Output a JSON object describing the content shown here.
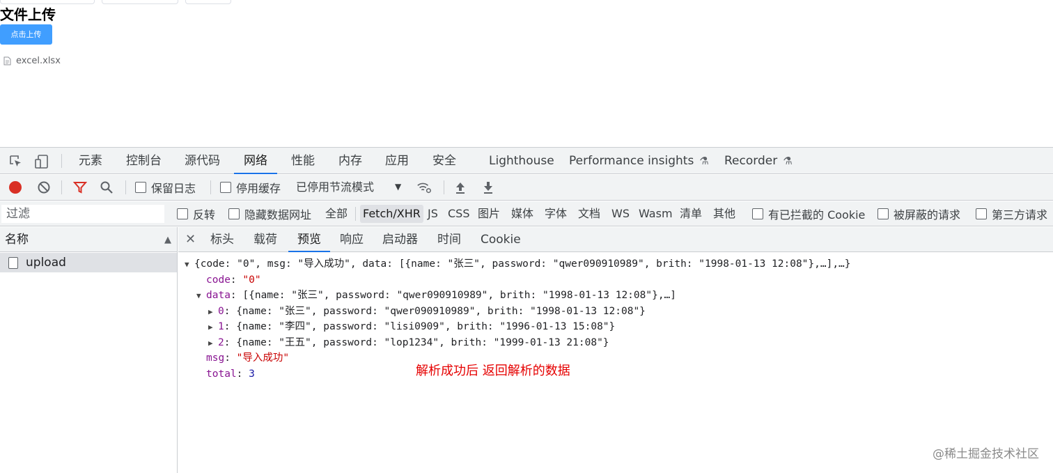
{
  "page": {
    "title": "文件上传",
    "upload_button": "点击上传",
    "file_name": "excel.xlsx"
  },
  "devtools": {
    "tabs": [
      "元素",
      "控制台",
      "源代码",
      "网络",
      "性能",
      "内存",
      "应用",
      "安全",
      "Lighthouse",
      "Performance insights",
      "Recorder"
    ],
    "active_tab": "网络",
    "toolbar": {
      "preserve_log": "保留日志",
      "disable_cache": "停用缓存",
      "throttling": "已停用节流模式"
    },
    "filter": {
      "placeholder": "过滤",
      "invert": "反转",
      "hide_data_urls": "隐藏数据网址",
      "types": [
        "全部",
        "Fetch/XHR",
        "JS",
        "CSS",
        "图片",
        "媒体",
        "字体",
        "文档",
        "WS",
        "Wasm",
        "清单",
        "其他"
      ],
      "selected_type": "Fetch/XHR",
      "blocked_cookies": "有已拦截的 Cookie",
      "blocked_requests": "被屏蔽的请求",
      "third_party": "第三方请求"
    },
    "request_list": {
      "column_name": "名称",
      "requests": [
        "upload"
      ]
    },
    "detail_tabs": [
      "标头",
      "载荷",
      "预览",
      "响应",
      "启动器",
      "时间",
      "Cookie"
    ],
    "active_detail_tab": "预览",
    "preview": {
      "summary": "{code: \"0\", msg: \"导入成功\", data: [{name: \"张三\", password: \"qwer090910989\", brith: \"1998-01-13 12:08\"},…],…}",
      "code_key": "code",
      "code_value": "\"0\"",
      "data_key": "data",
      "data_summary": "[{name: \"张三\", password: \"qwer090910989\", brith: \"1998-01-13 12:08\"},…]",
      "rows": [
        {
          "index": "0",
          "text": "{name: \"张三\", password: \"qwer090910989\", brith: \"1998-01-13 12:08\"}"
        },
        {
          "index": "1",
          "text": "{name: \"李四\", password: \"lisi0909\", brith: \"1996-01-13 15:08\"}"
        },
        {
          "index": "2",
          "text": "{name: \"王五\", password: \"lop1234\", brith: \"1999-01-13 21:08\"}"
        }
      ],
      "msg_key": "msg",
      "msg_value": "\"导入成功\"",
      "total_key": "total",
      "total_value": "3"
    }
  },
  "annotation": "解析成功后 返回解析的数据",
  "watermark": "@稀土掘金技术社区",
  "colors": {
    "accent": "#1a73e8",
    "upload_button": "#409eff",
    "annotation": "#e60000",
    "record": "#d93025",
    "filter_icon": "#d93025"
  }
}
